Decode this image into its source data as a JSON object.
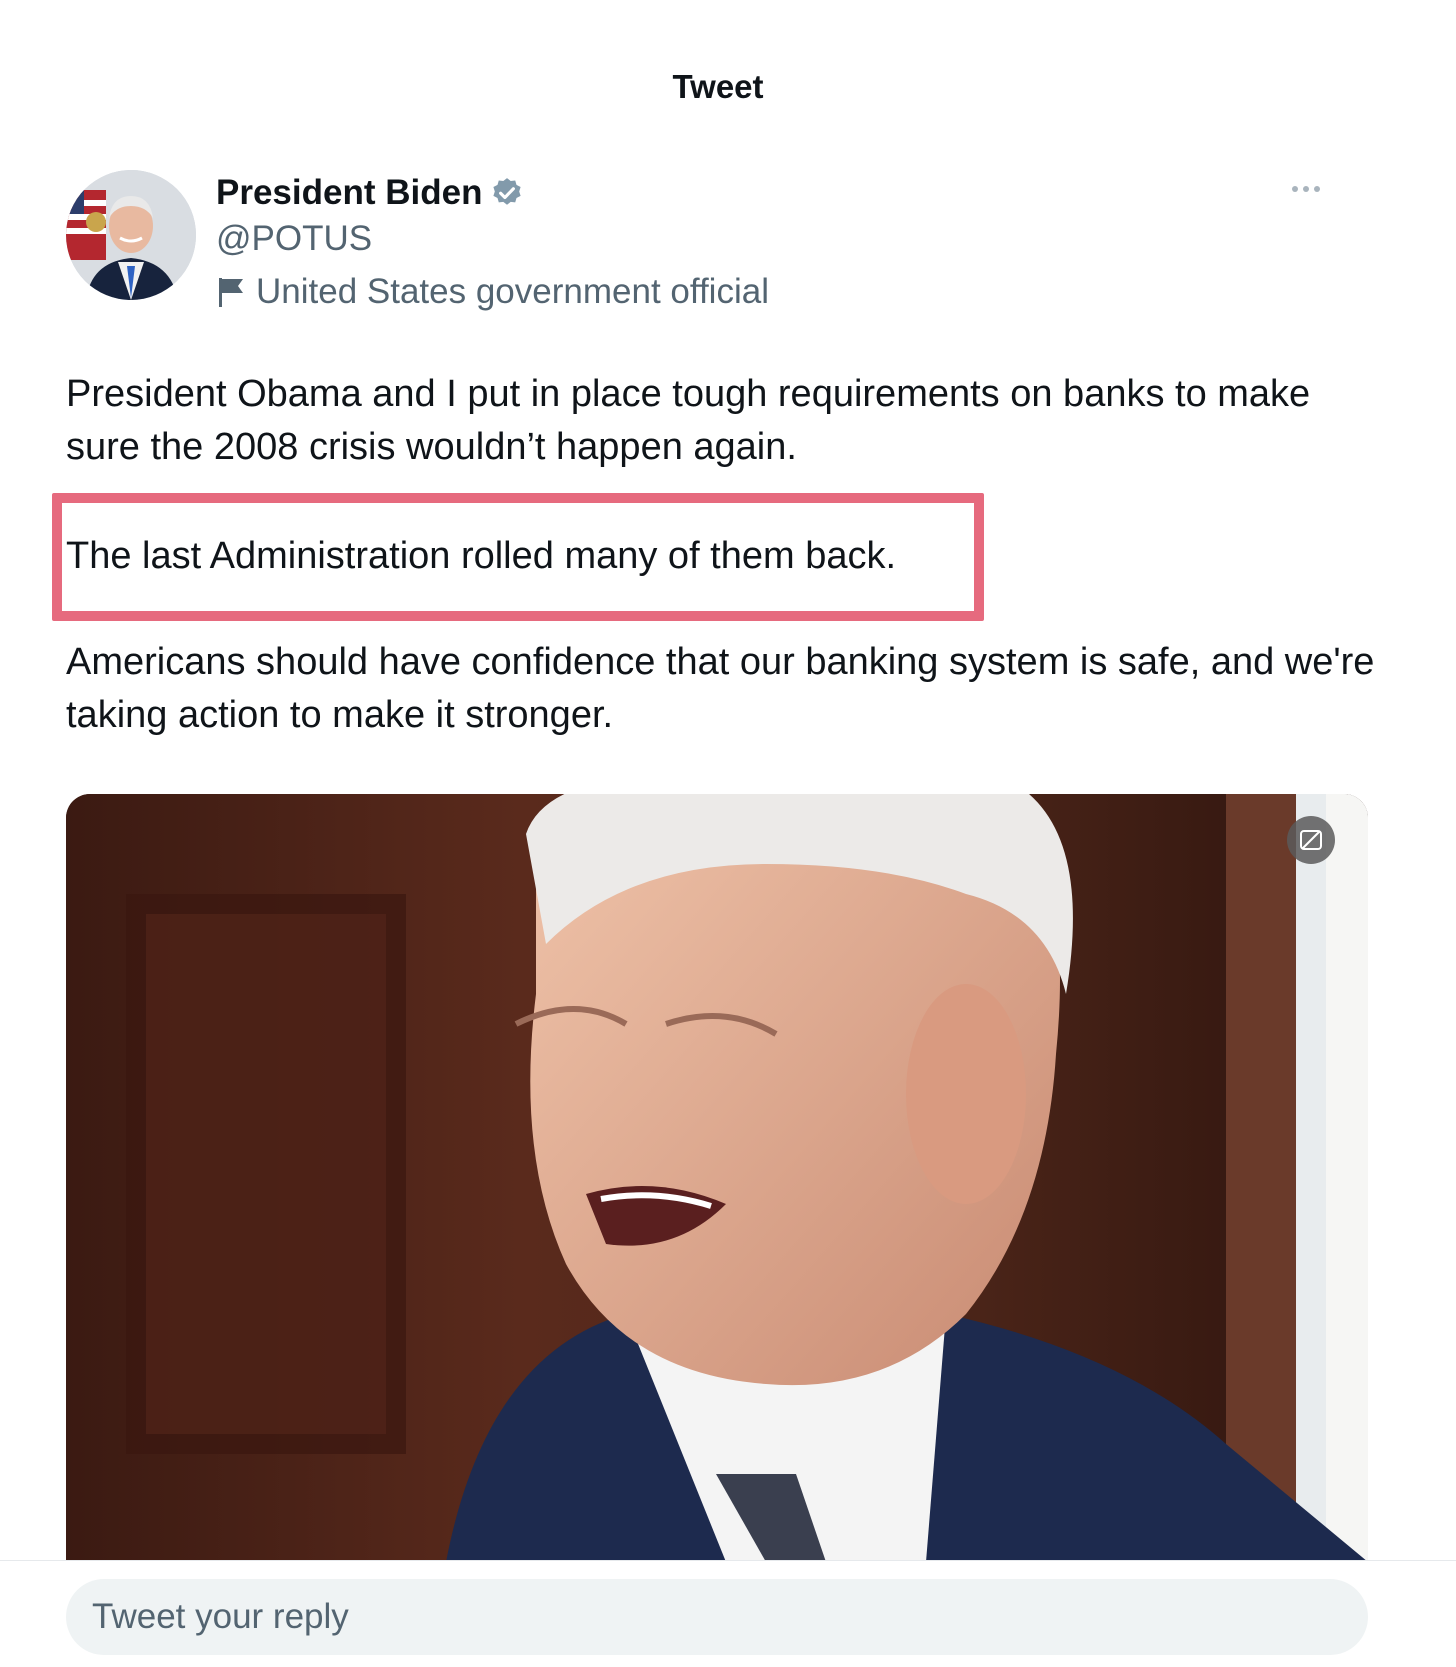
{
  "header": {
    "title": "Tweet"
  },
  "author": {
    "display_name": "President Biden",
    "handle": "@POTUS",
    "affiliation": "United States government official",
    "verified_color": "#829aab"
  },
  "tweet": {
    "paragraph_1": "President Obama and I put in place tough requirements on banks to make sure the 2008 crisis wouldn’t happen again.",
    "paragraph_2": "The last Administration rolled many of them back.",
    "paragraph_3": "Americans should have confidence that our banking system is safe, and we're taking action to make it stronger.",
    "highlight_color": "#e66a7e"
  },
  "icons": {
    "more": "more-horizontal-icon",
    "verified": "verified-badge-icon",
    "affiliation": "flag-icon",
    "media_alt": "sensitive-media-icon"
  },
  "reply": {
    "placeholder": "Tweet your reply"
  }
}
